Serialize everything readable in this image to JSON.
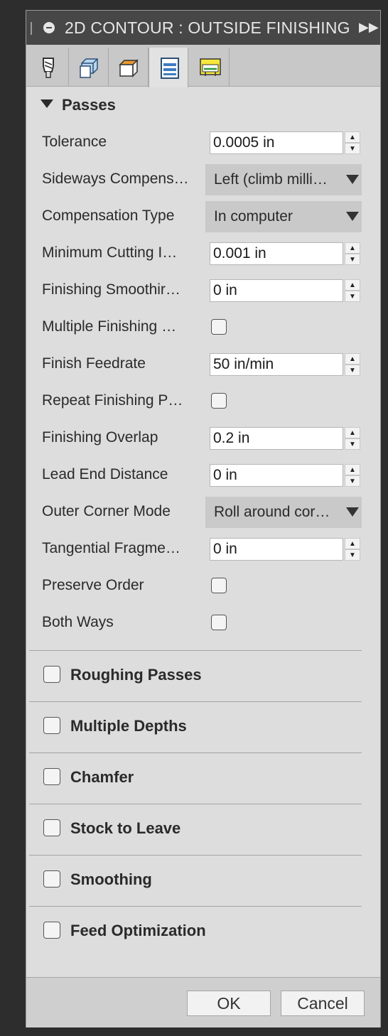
{
  "dialog": {
    "title": "2D CONTOUR : OUTSIDE FINISHING"
  },
  "tabs": [
    {
      "name": "tool",
      "icon": "tool-icon"
    },
    {
      "name": "geometry",
      "icon": "geometry-icon"
    },
    {
      "name": "heights",
      "icon": "heights-icon"
    },
    {
      "name": "passes",
      "icon": "passes-icon",
      "active": true
    },
    {
      "name": "linking",
      "icon": "linking-icon"
    }
  ],
  "passes": {
    "header": "Passes",
    "tolerance": {
      "label": "Tolerance",
      "value": "0.0005 in"
    },
    "sideways_compensation": {
      "label": "Sideways Compens…",
      "value": "Left (climb milli…"
    },
    "compensation_type": {
      "label": "Compensation Type",
      "value": "In computer"
    },
    "minimum_cutting": {
      "label": "Minimum Cutting I…",
      "value": "0.001 in"
    },
    "finishing_smoothing": {
      "label": "Finishing Smoothir…",
      "value": "0 in"
    },
    "multiple_finishing": {
      "label": "Multiple Finishing …",
      "checked": false
    },
    "finish_feedrate": {
      "label": "Finish Feedrate",
      "value": "50 in/min"
    },
    "repeat_finishing": {
      "label": "Repeat Finishing P…",
      "checked": false
    },
    "finishing_overlap": {
      "label": "Finishing Overlap",
      "value": "0.2 in"
    },
    "lead_end_distance": {
      "label": "Lead End Distance",
      "value": "0 in"
    },
    "outer_corner_mode": {
      "label": "Outer Corner Mode",
      "value": "Roll around cor…"
    },
    "tangential_fragment": {
      "label": "Tangential Fragme…",
      "value": "0 in"
    },
    "preserve_order": {
      "label": "Preserve Order",
      "checked": false
    },
    "both_ways": {
      "label": "Both Ways",
      "checked": false
    }
  },
  "groups": {
    "roughing_passes": "Roughing Passes",
    "multiple_depths": "Multiple Depths",
    "chamfer": "Chamfer",
    "stock_to_leave": "Stock to Leave",
    "smoothing": "Smoothing",
    "feed_optimization": "Feed Optimization"
  },
  "buttons": {
    "ok": "OK",
    "cancel": "Cancel"
  }
}
